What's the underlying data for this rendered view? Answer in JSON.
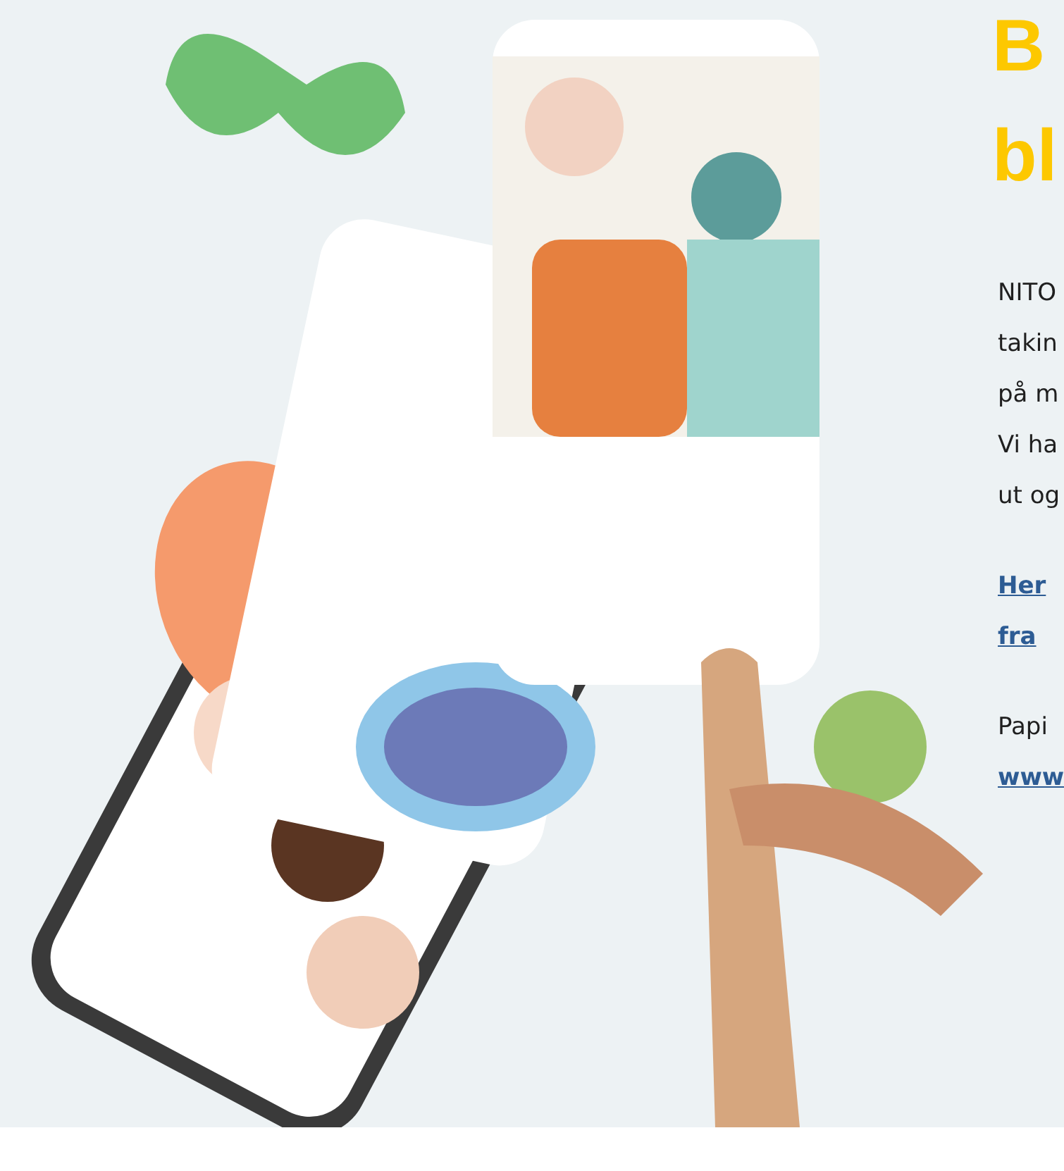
{
  "heading_lines": [
    "B",
    "bl"
  ],
  "paragraph_lines": [
    "NITO",
    "takin",
    "på m",
    "Vi ha",
    "ut og"
  ],
  "link_lines": [
    "Her",
    "fra"
  ],
  "note_lines": [
    {
      "text": "Papi",
      "kind": "text"
    },
    {
      "text": "www",
      "kind": "link"
    }
  ]
}
